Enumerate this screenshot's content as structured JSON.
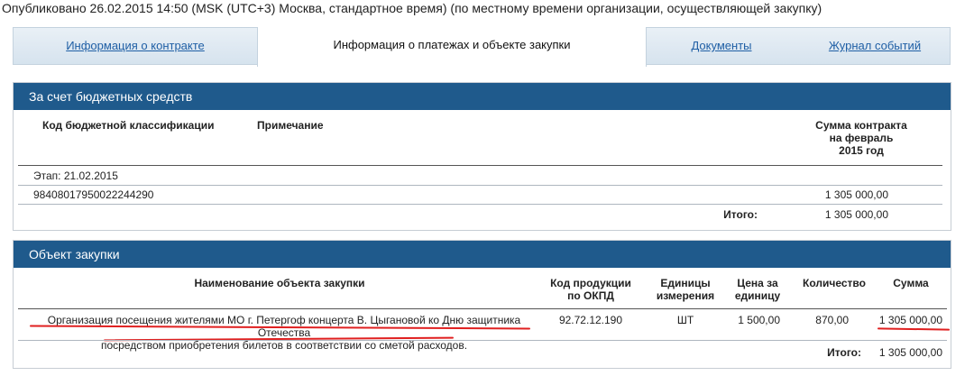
{
  "published": "Опубликовано 26.02.2015 14:50 (MSK (UTC+3) Москва, стандартное время) (по местному времени организации, осуществляющей закупку)",
  "tabs": [
    {
      "label": "Информация о контракте"
    },
    {
      "label": "Информация о платежах и объекте закупки"
    },
    {
      "label": "Документы"
    },
    {
      "label": "Журнал событий"
    }
  ],
  "budget": {
    "title": "За счет бюджетных средств",
    "headers": {
      "code": "Код бюджетной классификации",
      "note": "Примечание",
      "sum_line1": "Сумма контракта",
      "sum_line2": "на февраль",
      "sum_line3": "2015 год"
    },
    "stage": "Этап: 21.02.2015",
    "row_code": "98408017950022244290",
    "row_sum": "1 305 000,00",
    "total_label": "Итого:",
    "total_value": "1 305 000,00"
  },
  "purchase": {
    "title": "Объект закупки",
    "headers": {
      "name": "Наименование объекта закупки",
      "okpd_line1": "Код продукции",
      "okpd_line2": "по ОКПД",
      "unit_line1": "Единицы",
      "unit_line2": "измерения",
      "price_line1": "Цена за",
      "price_line2": "единицу",
      "qty": "Количество",
      "sum": "Сумма"
    },
    "row": {
      "name_line1": "Организация посещения жителями МО г. Петергоф концерта В. Цыгановой ко Дню защитника Отечества",
      "name_line2": "посредством приобретения билетов в соответствии со сметой расходов.",
      "okpd": "92.72.12.190",
      "unit": "ШТ",
      "price": "1 500,00",
      "qty": "870,00",
      "sum": "1 305 000,00"
    },
    "total_label": "Итого:",
    "total_value": "1 305 000,00"
  },
  "colors": {
    "header_blue": "#1f5a8c",
    "link_blue": "#1f5fa5",
    "annotation_red": "#e02020"
  }
}
